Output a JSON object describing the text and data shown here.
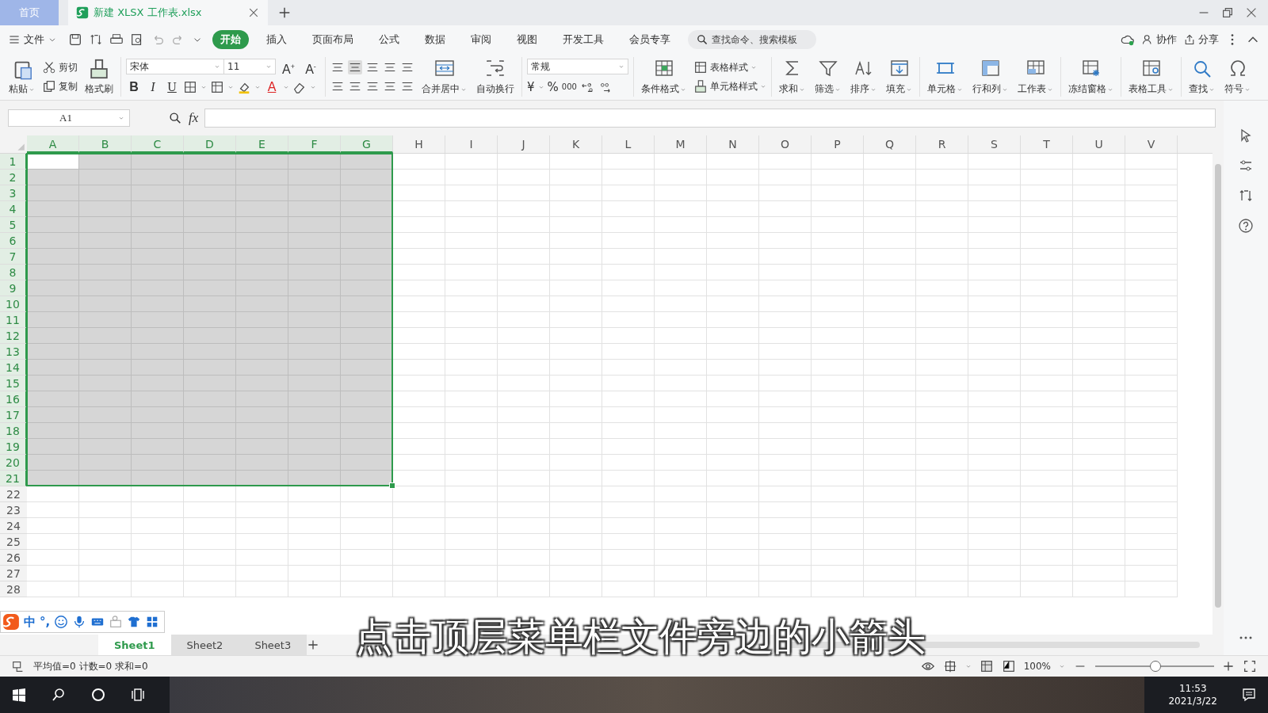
{
  "app_tabs": [
    {
      "label": "首页",
      "kind": "home",
      "selected": false
    },
    {
      "label": "新建 XLSX 工作表.xlsx",
      "kind": "doc",
      "selected": true
    }
  ],
  "menu": {
    "file": "文件",
    "tabs": [
      {
        "label": "开始",
        "selected": true
      },
      {
        "label": "插入",
        "selected": false
      },
      {
        "label": "页面布局",
        "selected": false
      },
      {
        "label": "公式",
        "selected": false
      },
      {
        "label": "数据",
        "selected": false
      },
      {
        "label": "审阅",
        "selected": false
      },
      {
        "label": "视图",
        "selected": false
      },
      {
        "label": "开发工具",
        "selected": false
      },
      {
        "label": "会员专享",
        "selected": false
      }
    ],
    "search": {
      "placeholder": "查找命令、搜索模板"
    },
    "actions": [
      "协作",
      "分享"
    ]
  },
  "ribbon": [
    {
      "kind": "clipboard",
      "paste": "粘贴",
      "cut": "剪切",
      "copy": "复制",
      "brush": "格式刷"
    },
    {
      "kind": "font",
      "font": "宋体",
      "size": "11",
      "grow": "A$^{+}$",
      "shrink": "A$^{-}$",
      "bold": "B",
      "italic": "I",
      "underline": "U",
      "color_letter": "A"
    },
    {
      "kind": "align"
    },
    {
      "kind": "large",
      "label": "合并居中",
      "dropdown": true
    },
    {
      "kind": "large",
      "label": "自动换行",
      "dropdown": false
    },
    {
      "kind": "number",
      "format": "常规",
      "currency": "¥",
      "percent": "%",
      "thousands": "000"
    },
    {
      "kind": "large",
      "label": "条件格式",
      "dropdown": true
    },
    {
      "kind": "stack",
      "items": [
        {
          "label": "表格样式",
          "dropdown": true
        },
        {
          "label": "单元格样式",
          "dropdown": true
        }
      ]
    },
    {
      "kind": "large",
      "label": "求和",
      "dropdown": true
    },
    {
      "kind": "large",
      "label": "筛选",
      "dropdown": true
    },
    {
      "kind": "large",
      "label": "排序",
      "dropdown": true
    },
    {
      "kind": "large",
      "label": "填充",
      "dropdown": true
    },
    {
      "kind": "large",
      "label": "单元格",
      "dropdown": true
    },
    {
      "kind": "large",
      "label": "行和列",
      "dropdown": true
    },
    {
      "kind": "large",
      "label": "工作表",
      "dropdown": true
    },
    {
      "kind": "large",
      "label": "冻结窗格",
      "dropdown": true
    },
    {
      "kind": "large",
      "label": "表格工具",
      "dropdown": true
    },
    {
      "kind": "large",
      "label": "查找",
      "dropdown": true
    },
    {
      "kind": "large",
      "label": "符号",
      "dropdown": true
    }
  ],
  "name_box": "A1",
  "formula_label": "fx",
  "columns": [
    {
      "label": "A",
      "selected": true
    },
    {
      "label": "B",
      "selected": true
    },
    {
      "label": "C",
      "selected": true
    },
    {
      "label": "D",
      "selected": true
    },
    {
      "label": "E",
      "selected": true
    },
    {
      "label": "F",
      "selected": true
    },
    {
      "label": "G",
      "selected": true
    },
    {
      "label": "H",
      "selected": false
    },
    {
      "label": "I",
      "selected": false
    },
    {
      "label": "J",
      "selected": false
    },
    {
      "label": "K",
      "selected": false
    },
    {
      "label": "L",
      "selected": false
    },
    {
      "label": "M",
      "selected": false
    },
    {
      "label": "N",
      "selected": false
    },
    {
      "label": "O",
      "selected": false
    },
    {
      "label": "P",
      "selected": false
    },
    {
      "label": "Q",
      "selected": false
    },
    {
      "label": "R",
      "selected": false
    },
    {
      "label": "S",
      "selected": false
    },
    {
      "label": "T",
      "selected": false
    },
    {
      "label": "U",
      "selected": false
    },
    {
      "label": "V",
      "selected": false
    }
  ],
  "rows": [
    {
      "label": "1",
      "selected": true
    },
    {
      "label": "2",
      "selected": true
    },
    {
      "label": "3",
      "selected": true
    },
    {
      "label": "4",
      "selected": true
    },
    {
      "label": "5",
      "selected": true
    },
    {
      "label": "6",
      "selected": true
    },
    {
      "label": "7",
      "selected": true
    },
    {
      "label": "8",
      "selected": true
    },
    {
      "label": "9",
      "selected": true
    },
    {
      "label": "10",
      "selected": true
    },
    {
      "label": "11",
      "selected": true
    },
    {
      "label": "12",
      "selected": true
    },
    {
      "label": "13",
      "selected": true
    },
    {
      "label": "14",
      "selected": true
    },
    {
      "label": "15",
      "selected": true
    },
    {
      "label": "16",
      "selected": true
    },
    {
      "label": "17",
      "selected": true
    },
    {
      "label": "18",
      "selected": true
    },
    {
      "label": "19",
      "selected": true
    },
    {
      "label": "20",
      "selected": true
    },
    {
      "label": "21",
      "selected": true
    },
    {
      "label": "22",
      "selected": false
    },
    {
      "label": "23",
      "selected": false
    },
    {
      "label": "24",
      "selected": false
    },
    {
      "label": "25",
      "selected": false
    },
    {
      "label": "26",
      "selected": false
    },
    {
      "label": "27",
      "selected": false
    },
    {
      "label": "28",
      "selected": false
    }
  ],
  "sheets": [
    {
      "label": "Sheet1",
      "selected": true
    },
    {
      "label": "Sheet2",
      "selected": false
    },
    {
      "label": "Sheet3",
      "selected": false
    }
  ],
  "status": "平均值=0 计数=0 求和=0",
  "zoom": "100%",
  "zoom_slider": {
    "level": 0.5
  },
  "ime": {
    "mode": "中",
    "punct": "°,"
  },
  "caption": "点击顶层菜单栏文件旁边的小箭头",
  "taskbar": {
    "time": "11:53",
    "date": "2021/3/22"
  }
}
